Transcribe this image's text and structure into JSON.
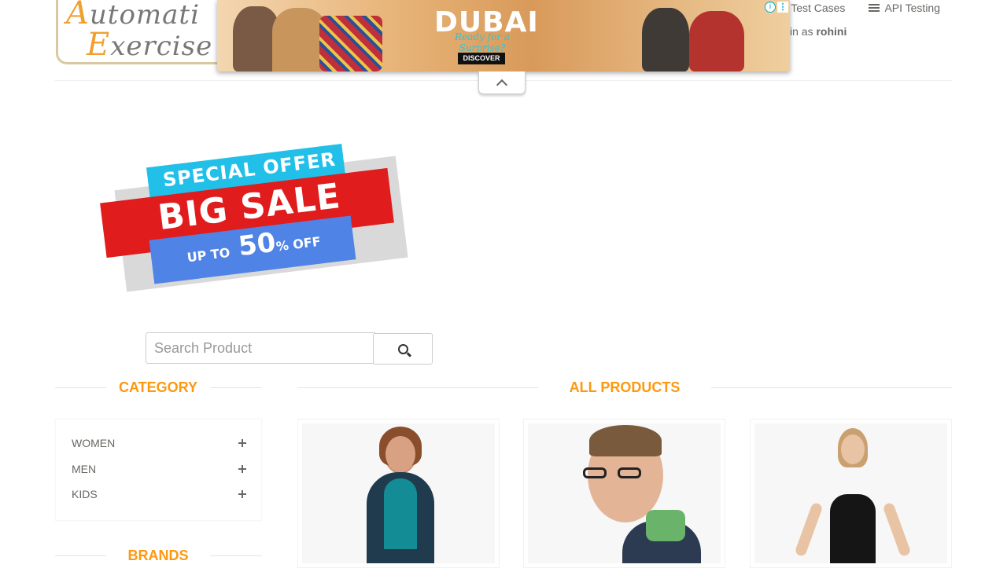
{
  "logo": {
    "line1_cap": "A",
    "line1_rest": "utomati",
    "line2_cap": "E",
    "line2_rest": "xercise"
  },
  "nav": {
    "test_cases": "Test Cases",
    "api_testing": "API Testing"
  },
  "user": {
    "logged_in_prefix": "in as",
    "username": "rohini"
  },
  "ad": {
    "title": "DUBAI",
    "tagline": "Ready for a Surprise?",
    "cta": "DISCOVER",
    "info": "i",
    "menu": "⋮"
  },
  "promo": {
    "line1": "SPECIAL OFFER",
    "line2": "BIG SALE",
    "line3_small": "UP TO",
    "line3_big": "50",
    "line3_suffix": "% OFF"
  },
  "search": {
    "placeholder": "Search Product"
  },
  "sidebar": {
    "category_title": "CATEGORY",
    "categories": [
      {
        "label": "WOMEN"
      },
      {
        "label": "MEN"
      },
      {
        "label": "KIDS"
      }
    ],
    "brands_title": "BRANDS"
  },
  "main": {
    "title": "ALL PRODUCTS"
  },
  "colors": {
    "accent": "#fe980f",
    "text": "#696763"
  }
}
